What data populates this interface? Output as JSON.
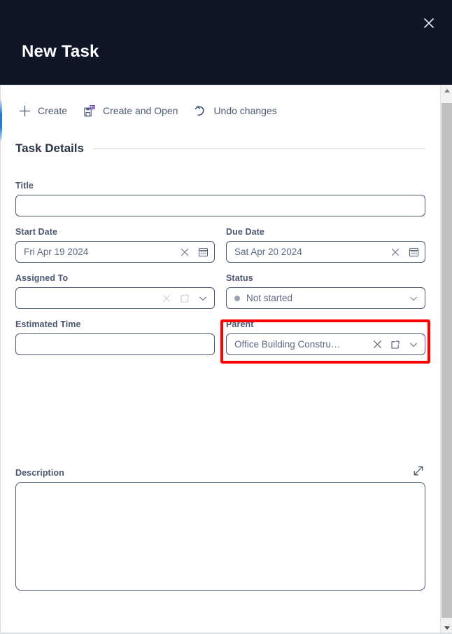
{
  "header": {
    "title": "New Task",
    "close_icon": "close-icon",
    "bg_color": "#101628"
  },
  "toolbar": {
    "items": [
      {
        "label": "Create",
        "icon": "plus-icon"
      },
      {
        "label": "Create and Open",
        "icon": "save-and-open-icon"
      },
      {
        "label": "Undo changes",
        "icon": "undo-icon"
      }
    ]
  },
  "section": {
    "title": "Task Details"
  },
  "fields": {
    "title": {
      "label": "Title",
      "value": "",
      "placeholder": ""
    },
    "start_date": {
      "label": "Start Date",
      "value": "Fri Apr 19 2024",
      "clear_icon": "clear-x-icon",
      "calendar_icon": "calendar-icon"
    },
    "due_date": {
      "label": "Due Date",
      "value": "Sat Apr 20 2024",
      "clear_icon": "clear-x-icon",
      "calendar_icon": "calendar-icon"
    },
    "assigned_to": {
      "label": "Assigned To",
      "value": "",
      "clear_icon": "clear-x-icon",
      "open_icon": "open-external-icon",
      "chevron_icon": "chevron-down-icon"
    },
    "status": {
      "label": "Status",
      "value": "Not started",
      "dot_color": "#9aa2b1",
      "chevron_icon": "chevron-down-icon"
    },
    "estimated_time": {
      "label": "Estimated Time",
      "value": ""
    },
    "parent": {
      "label": "Parent",
      "value": "Office Building Constru…",
      "clear_icon": "clear-x-icon",
      "open_icon": "open-external-icon",
      "chevron_icon": "chevron-down-icon",
      "highlighted": true,
      "highlight_color": "#fe0000"
    },
    "description": {
      "label": "Description",
      "value": "",
      "expand_icon": "expand-diagonal-icon"
    }
  },
  "scrollbar": {
    "up_icon": "scroll-up-arrow-icon",
    "down_icon": "scroll-down-arrow-icon"
  },
  "colors": {
    "header_bg": "#101628",
    "field_border": "#4a5673",
    "label_text": "#4b5670",
    "value_text": "#5d6881",
    "accent_blue": "#1c7ed6",
    "highlight_red": "#fe0000"
  }
}
